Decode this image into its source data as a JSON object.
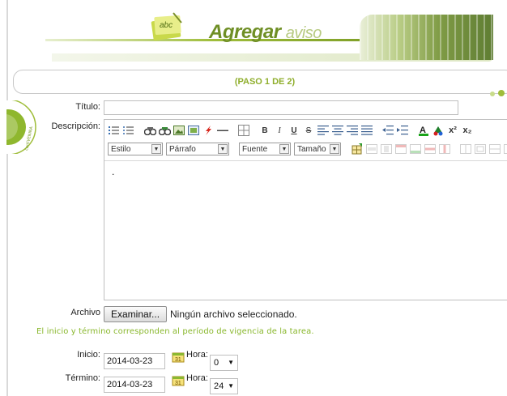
{
  "header": {
    "title_bold": "Agregar",
    "title_light": "aviso",
    "logo_text": "abc",
    "step": "(PASO 1 DE 2)"
  },
  "seal_text": "certiVENINA",
  "form": {
    "titulo_label": "Título:",
    "titulo_value": "",
    "descripcion_label": "Descripción:",
    "editor": {
      "style_select": "Estilo",
      "paragraph_select": "Párrafo",
      "font_select": "Fuente",
      "size_select": "Tamaño",
      "content": "."
    },
    "archivo_label": "Archivo",
    "browse_button": "Examinar...",
    "file_status": "Ningún archivo seleccionado.",
    "note": "El inicio y término corresponden al período de vigencia de la tarea.",
    "inicio_label": "Inicio:",
    "inicio_value": "2014-03-23",
    "inicio_hora_label": "Hora:",
    "inicio_hora_value": "0",
    "termino_label": "Término:",
    "termino_value": "2014-03-23",
    "termino_hora_label": "Hora:",
    "termino_hora_value": "24"
  },
  "colors": {
    "accent_green": "#8fae2c",
    "note_green": "#8ab82e"
  }
}
